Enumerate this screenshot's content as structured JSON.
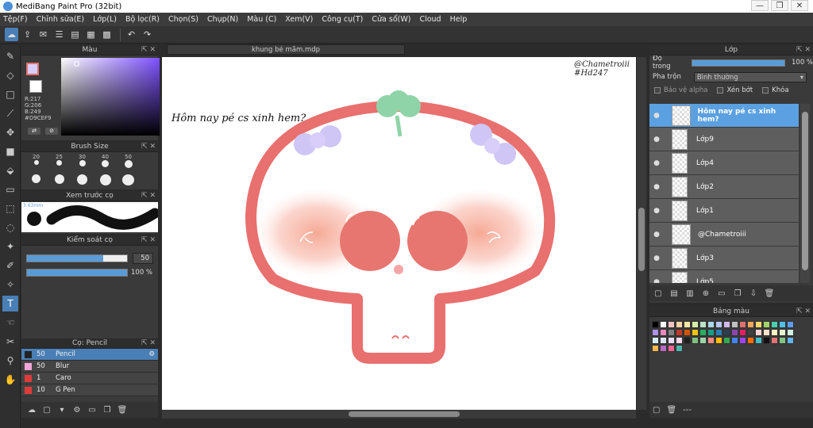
{
  "app": {
    "title": "MediBang Paint Pro (32bit)"
  },
  "window_buttons": [
    "—",
    "❐",
    "✕"
  ],
  "menu": [
    "Tệp(F)",
    "Chỉnh sửa(E)",
    "Lớp(L)",
    "Bộ lọc(R)",
    "Chọn(S)",
    "Chụp(N)",
    "Màu (C)",
    "Xem(V)",
    "Công cụ(T)",
    "Cửa sổ(W)",
    "Cloud",
    "Help"
  ],
  "color_panel": {
    "title": "Màu",
    "main_color": "#D9CEF9",
    "rgb_r": "R:217",
    "rgb_g": "G:206",
    "rgb_b": "B:249",
    "hex": "#D9CEF9"
  },
  "brush_size": {
    "title": "Brush Size",
    "sizes": [
      "20",
      "25",
      "30",
      "40",
      "50"
    ]
  },
  "preview": {
    "title": "Xem trước cọ",
    "size_label": "3.63mm"
  },
  "brush_control": {
    "title": "Kiểm soát cọ",
    "size_value": "50",
    "size_fill": 0.76,
    "opacity_value": "100 %",
    "opacity_fill": 1.0
  },
  "brush_list": {
    "title": "Cọ: Pencil",
    "items": [
      {
        "num": "50",
        "name": "Pencil",
        "color": "#222222",
        "selected": true
      },
      {
        "num": "50",
        "name": "Blur",
        "color": "#f4a6d8",
        "selected": false
      },
      {
        "num": "1",
        "name": "Caro",
        "color": "#e03a3a",
        "selected": false
      },
      {
        "num": "10",
        "name": "G Pen",
        "color": "#e03a3a",
        "selected": false
      }
    ]
  },
  "document": {
    "tab": "khung bé mãm.mdp",
    "credit_line1": "@Chametroiii",
    "credit_line2": "#Hd247",
    "caption": "Hôm nay pé cs xinh hem?"
  },
  "layer_panel": {
    "title": "Lớp",
    "opacity_label": "Độ trong",
    "opacity_value": "100 %",
    "blend_label": "Pha trộn",
    "blend_value": "Bình thường",
    "protect_alpha": "Bảo vệ alpha",
    "clipping": "Xén bớt",
    "lock": "Khóa",
    "layers": [
      {
        "name": "Hôm nay pé cs xinh hem?",
        "selected": true
      },
      {
        "name": "Lớp9",
        "selected": false
      },
      {
        "name": "Lớp4",
        "selected": false
      },
      {
        "name": "Lớp2",
        "selected": false
      },
      {
        "name": "Lớp1",
        "selected": false
      },
      {
        "name": "@Chametroiii",
        "selected": false
      },
      {
        "name": "Lớp3",
        "selected": false
      },
      {
        "name": "Lớp5",
        "selected": false
      }
    ]
  },
  "palette_panel": {
    "title": "Bảng màu",
    "footer": "---",
    "colors": [
      "#000000",
      "#ffffff",
      "#f4c2c2",
      "#f9d5a7",
      "#fbe7a1",
      "#d7f0a8",
      "#b9e3c6",
      "#a9d8e8",
      "#b5c7f0",
      "#d2b9ee",
      "#c0c0c0",
      "#e07070",
      "#f2a65a",
      "#f5d76e",
      "#a0d468",
      "#48cfad",
      "#4fc1e9",
      "#5d9cec",
      "#ac92ec",
      "#ec87c0",
      "#808080",
      "#c0392b",
      "#d35400",
      "#f1c40f",
      "#27ae60",
      "#16a085",
      "#2980b9",
      "#2c3e50",
      "#8e44ad",
      "#e91e63",
      "#404040",
      "#fad4d4",
      "#fde3c8",
      "#fff3c4",
      "#e3f5cf",
      "#d1f0e0",
      "#d6ecf5",
      "#dde4f8",
      "#eadcf7",
      "#f7d9ea",
      "#202020",
      "#7fbf7f",
      "#9fd4a8",
      "#f28b82",
      "#fbbc04",
      "#34a853",
      "#4285f4",
      "#a142f4",
      "#ff6d01",
      "#46bdc6",
      "#111111",
      "#e57373",
      "#81c784",
      "#64b5f6",
      "#ffb74d",
      "#ba68c8",
      "#f06292",
      "#4db6ac"
    ]
  },
  "canvas_colors": {
    "outline": "#e8706e",
    "blush": "#f5a48f",
    "eyes": "#e87670",
    "bow": "#cfc6f5",
    "leaf": "#8fd4a8"
  }
}
